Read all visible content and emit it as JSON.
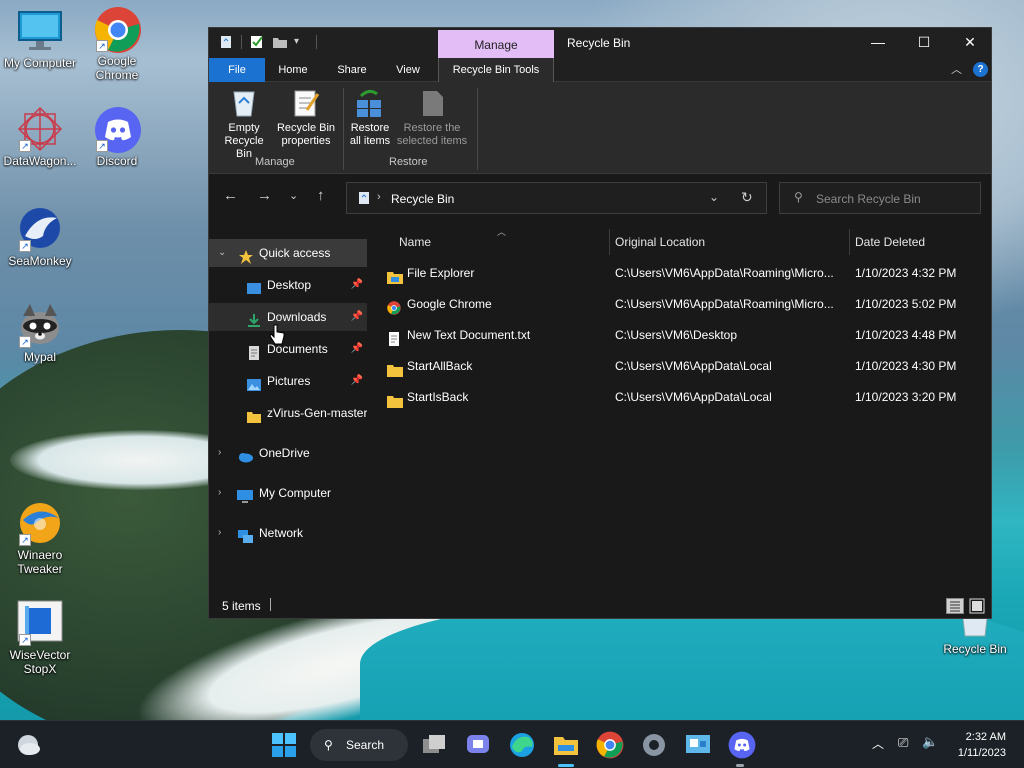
{
  "desktop": {
    "icons": [
      {
        "label": "My Computer"
      },
      {
        "label": "Google Chrome"
      },
      {
        "label": "DataWagon..."
      },
      {
        "label": "Discord"
      },
      {
        "label": "SeaMonkey"
      },
      {
        "label": "Mypal"
      },
      {
        "label": "Winaero Tweaker"
      },
      {
        "label": "WiseVector StopX"
      },
      {
        "label": "Recycle Bin"
      }
    ]
  },
  "window": {
    "title": "Recycle Bin",
    "context_tab": "Manage",
    "tabs": {
      "file": "File",
      "home": "Home",
      "share": "Share",
      "view": "View",
      "tools": "Recycle Bin Tools"
    },
    "ribbon": {
      "empty": "Empty\nRecycle Bin",
      "props": "Recycle Bin\nproperties",
      "restore_all": "Restore\nall items",
      "restore_sel": "Restore the\nselected items",
      "group_manage": "Manage",
      "group_restore": "Restore"
    },
    "address": {
      "path": "Recycle Bin"
    },
    "search": {
      "placeholder": "Search Recycle Bin"
    },
    "nav": {
      "quick_access": "Quick access",
      "desktop": "Desktop",
      "downloads": "Downloads",
      "documents": "Documents",
      "pictures": "Pictures",
      "zvirus": "zVirus-Gen-master",
      "onedrive": "OneDrive",
      "mycomputer": "My Computer",
      "network": "Network"
    },
    "columns": {
      "name": "Name",
      "location": "Original Location",
      "date": "Date Deleted"
    },
    "files": [
      {
        "name": "File Explorer",
        "location": "C:\\Users\\VM6\\AppData\\Roaming\\Micro...",
        "date": "1/10/2023 4:32 PM"
      },
      {
        "name": "Google Chrome",
        "location": "C:\\Users\\VM6\\AppData\\Roaming\\Micro...",
        "date": "1/10/2023 5:02 PM"
      },
      {
        "name": "New Text Document.txt",
        "location": "C:\\Users\\VM6\\Desktop",
        "date": "1/10/2023 4:48 PM"
      },
      {
        "name": "StartAllBack",
        "location": "C:\\Users\\VM6\\AppData\\Local",
        "date": "1/10/2023 4:30 PM"
      },
      {
        "name": "StartIsBack",
        "location": "C:\\Users\\VM6\\AppData\\Local",
        "date": "1/10/2023 3:20 PM"
      }
    ],
    "status": {
      "count": "5 items"
    }
  },
  "taskbar": {
    "search_label": "Search",
    "time": "2:32 AM",
    "date": "1/11/2023"
  },
  "colors": {
    "accent": "#1b72d1",
    "manage_tab": "#e3bdf6",
    "window_bg": "#191919"
  }
}
